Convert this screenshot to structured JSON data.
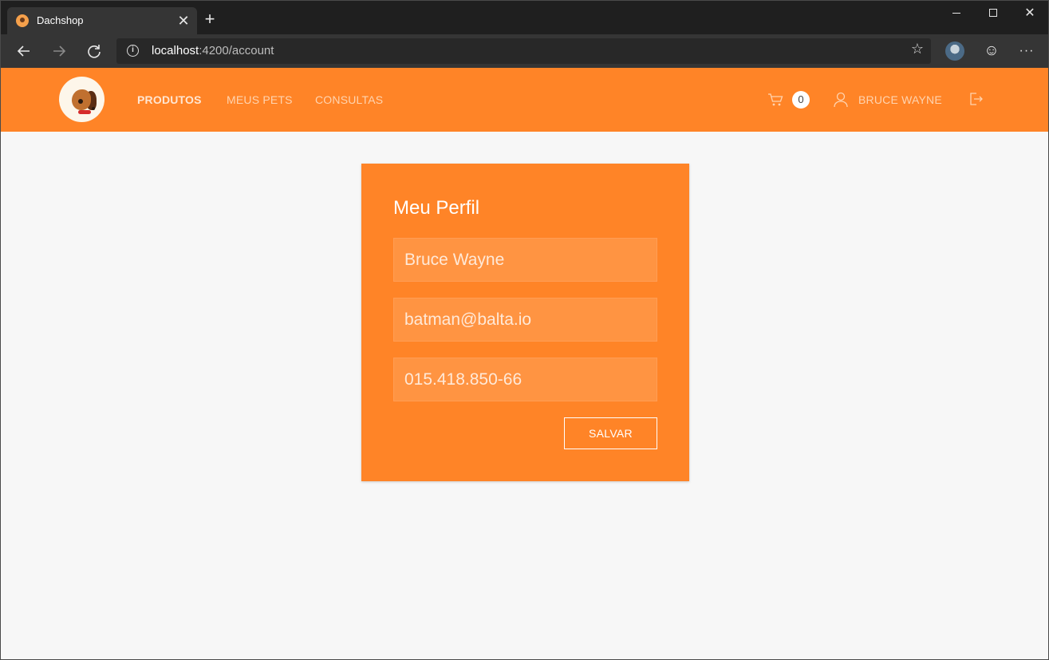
{
  "browser": {
    "tab_title": "Dachshop",
    "tab_close": "✕",
    "new_tab": "+",
    "url_host": "localhost",
    "url_rest": ":4200/account",
    "window_min": "",
    "window_max": "",
    "window_close": "✕",
    "more": "···"
  },
  "header": {
    "nav": [
      {
        "label": "PRODUTOS",
        "active": true
      },
      {
        "label": "MEUS PETS",
        "active": false
      },
      {
        "label": "CONSULTAS",
        "active": false
      }
    ],
    "cart_count": "0",
    "user_name": "BRUCE WAYNE"
  },
  "profile": {
    "title": "Meu Perfil",
    "name_value": "Bruce Wayne",
    "email_value": "batman@balta.io",
    "document_value": "015.418.850-66",
    "save_label": "SALVAR"
  },
  "colors": {
    "brand_orange": "#ff8427",
    "page_background": "#f7f7f7",
    "chrome_dark": "#1f1f1f"
  }
}
